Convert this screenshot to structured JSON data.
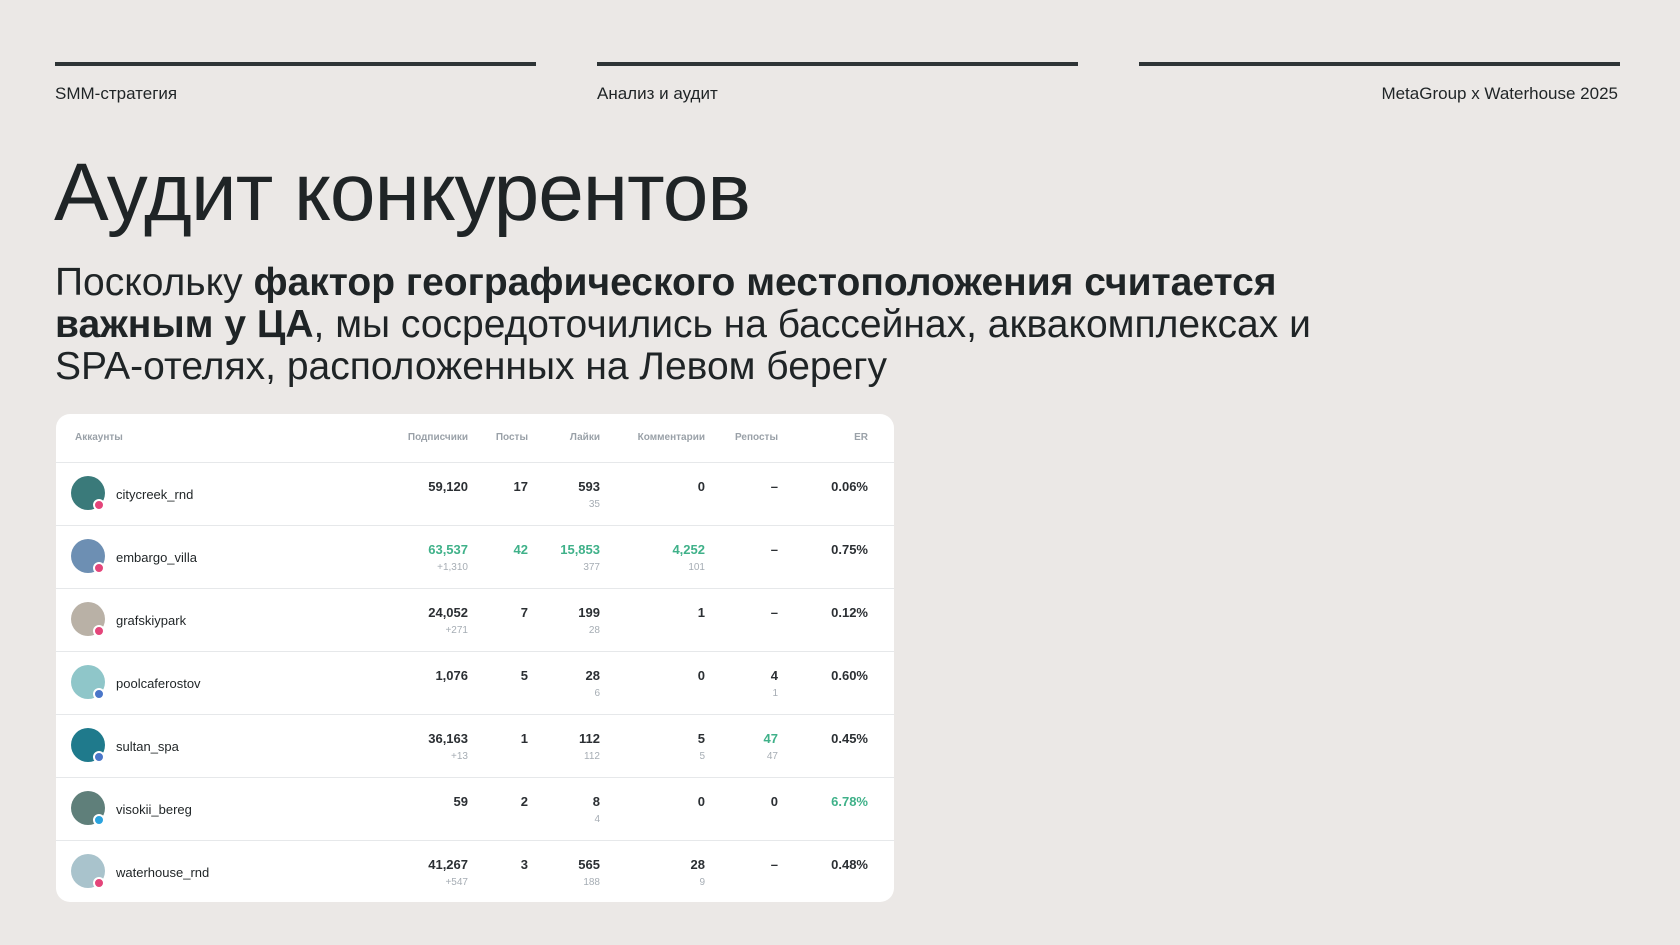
{
  "header": {
    "left": "SMM-стратегия",
    "center": "Анализ и аудит",
    "right": "MetaGroup x Waterhouse 2025"
  },
  "title": "Аудит конкурентов",
  "subtitle": {
    "part1": "Поскольку ",
    "bold": "фактор географического местоположения считается важным у ЦА",
    "part2": ", мы сосредоточились на бассейнах, аквакомплексах и SPA-отелях, расположенных на Левом берегу"
  },
  "table": {
    "columns": [
      "Аккаунты",
      "Подписчики",
      "Посты",
      "Лайки",
      "Комментарии",
      "Репосты",
      "ER"
    ],
    "rows": [
      {
        "account": "citycreek_rnd",
        "network": "instagram",
        "avatar_color": "#3a7a7a",
        "subscribers": "59,120",
        "subscribers_sub": "",
        "posts": "17",
        "likes": "593",
        "likes_sub": "35",
        "comments": "0",
        "comments_sub": "",
        "reposts": "–",
        "reposts_sub": "",
        "er": "0.06%",
        "green": []
      },
      {
        "account": "embargo_villa",
        "network": "instagram",
        "avatar_color": "#6d8fb3",
        "subscribers": "63,537",
        "subscribers_sub": "+1,310",
        "posts": "42",
        "likes": "15,853",
        "likes_sub": "377",
        "comments": "4,252",
        "comments_sub": "101",
        "reposts": "–",
        "reposts_sub": "",
        "er": "0.75%",
        "green": [
          "subscribers",
          "posts",
          "likes",
          "comments"
        ]
      },
      {
        "account": "grafskiypark",
        "network": "instagram",
        "avatar_color": "#b9b1a6",
        "subscribers": "24,052",
        "subscribers_sub": "+271",
        "posts": "7",
        "likes": "199",
        "likes_sub": "28",
        "comments": "1",
        "comments_sub": "",
        "reposts": "–",
        "reposts_sub": "",
        "er": "0.12%",
        "green": []
      },
      {
        "account": "poolcaferostov",
        "network": "vk",
        "avatar_color": "#8fc6c9",
        "subscribers": "1,076",
        "subscribers_sub": "",
        "posts": "5",
        "likes": "28",
        "likes_sub": "6",
        "comments": "0",
        "comments_sub": "",
        "reposts": "4",
        "reposts_sub": "1",
        "er": "0.60%",
        "green": []
      },
      {
        "account": "sultan_spa",
        "network": "vk",
        "avatar_color": "#1f7a8c",
        "subscribers": "36,163",
        "subscribers_sub": "+13",
        "posts": "1",
        "likes": "112",
        "likes_sub": "112",
        "comments": "5",
        "comments_sub": "5",
        "reposts": "47",
        "reposts_sub": "47",
        "er": "0.45%",
        "green": [
          "reposts"
        ]
      },
      {
        "account": "visokii_bereg",
        "network": "telegram",
        "avatar_color": "#5f7f7a",
        "subscribers": "59",
        "subscribers_sub": "",
        "posts": "2",
        "likes": "8",
        "likes_sub": "4",
        "comments": "0",
        "comments_sub": "",
        "reposts": "0",
        "reposts_sub": "",
        "er": "6.78%",
        "green": [
          "er"
        ]
      },
      {
        "account": "waterhouse_rnd",
        "network": "instagram",
        "avatar_color": "#a9c3cc",
        "subscribers": "41,267",
        "subscribers_sub": "+547",
        "posts": "3",
        "likes": "565",
        "likes_sub": "188",
        "comments": "28",
        "comments_sub": "9",
        "reposts": "–",
        "reposts_sub": "",
        "er": "0.48%",
        "green": []
      }
    ]
  },
  "colors": {
    "background": "#ebe8e6",
    "accent_green": "#3fb189",
    "instagram": "#e4457a",
    "vk": "#4a76c9",
    "telegram": "#2aa3de"
  }
}
